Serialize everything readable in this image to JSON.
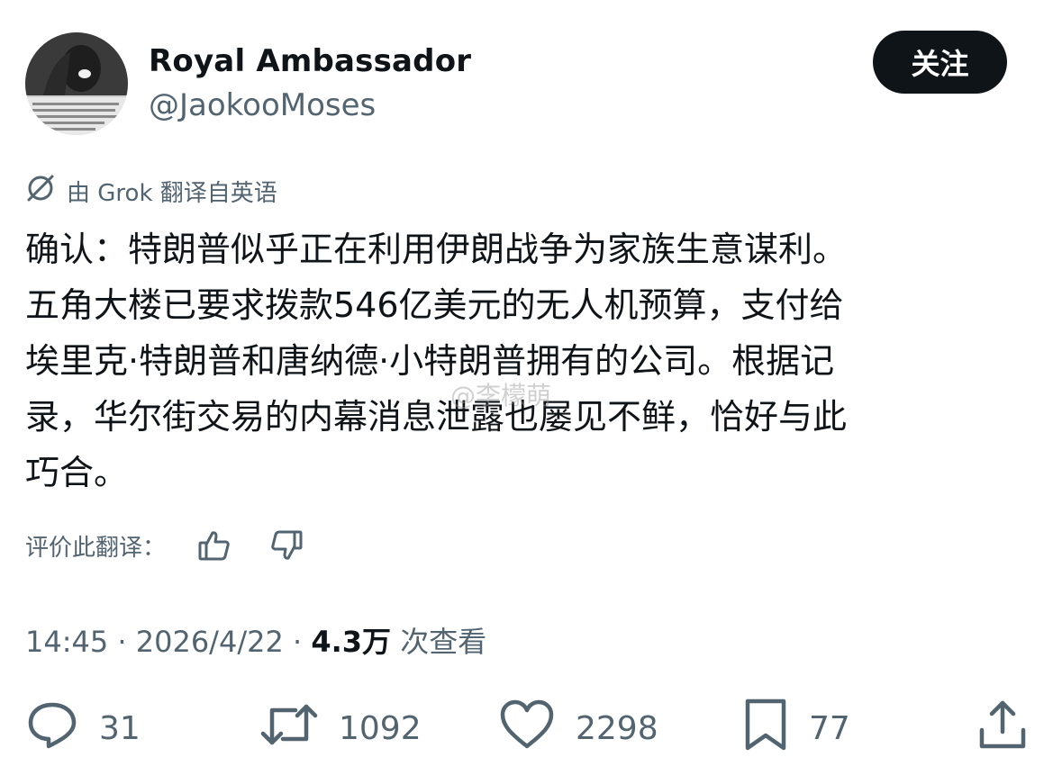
{
  "author": {
    "name": "Royal Ambassador",
    "handle": "@JaokooMoses",
    "avatar_alt": "avatar"
  },
  "follow_label": "关注",
  "translation_note": "由 Grok 翻译自英语",
  "tweet_lines": [
    "确认：特朗普似乎正在利用伊朗战争为家族生意谋利。",
    "五角大楼已要求拨款546亿美元的无人机预算，支付给",
    "埃里克·特朗普和唐纳德·小特朗普拥有的公司。根据记",
    "录，华尔街交易的内幕消息泄露也屡见不鲜，恰好与此",
    "巧合。"
  ],
  "watermark": "@李檬萌",
  "rate_label": "评价此翻译：",
  "meta": {
    "time": "14:45",
    "sep": " · ",
    "date": "2026/4/22",
    "views_count": "4.3万",
    "views_label": " 次查看"
  },
  "actions": {
    "replies": "31",
    "reposts": "1092",
    "likes": "2298",
    "bookmarks": "77"
  },
  "icons": {
    "translate": "grok-icon",
    "thumbs_up": "thumbs-up-icon",
    "thumbs_down": "thumbs-down-icon",
    "reply": "reply-icon",
    "repost": "repost-icon",
    "like": "heart-icon",
    "bookmark": "bookmark-icon",
    "share": "share-icon"
  },
  "colors": {
    "text": "#0f1419",
    "secondary": "#536471",
    "button_bg": "#0f1419",
    "button_text": "#ffffff"
  }
}
